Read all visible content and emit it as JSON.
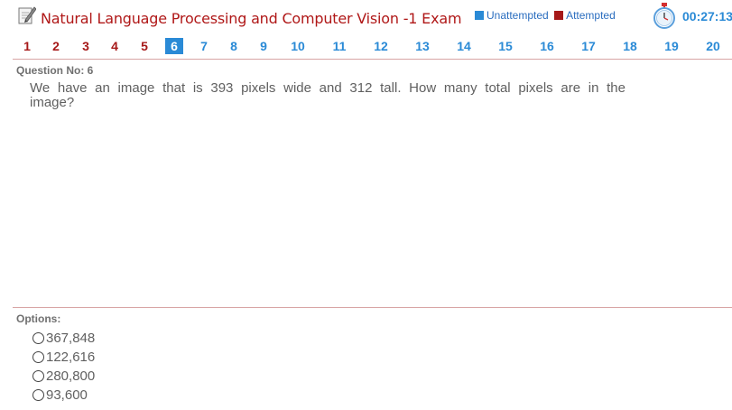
{
  "header": {
    "title": "Natural Language Processing and Computer Vision -1 Exam",
    "legend_unattempted": "Unattempted",
    "legend_attempted": "Attempted",
    "timer": "00:27:13"
  },
  "colors": {
    "attempted": "#a61919",
    "unattempted": "#2a8ad6",
    "current_bg": "#2a8ad6",
    "title": "#b01818"
  },
  "navigation": {
    "questions": [
      {
        "label": "1",
        "status": "attempted"
      },
      {
        "label": "2",
        "status": "attempted"
      },
      {
        "label": "3",
        "status": "attempted"
      },
      {
        "label": "4",
        "status": "attempted"
      },
      {
        "label": "5",
        "status": "attempted"
      },
      {
        "label": "6",
        "status": "current"
      },
      {
        "label": "7",
        "status": "unattempted"
      },
      {
        "label": "8",
        "status": "unattempted"
      },
      {
        "label": "9",
        "status": "unattempted"
      },
      {
        "label": "10",
        "status": "unattempted"
      },
      {
        "label": "11",
        "status": "unattempted"
      },
      {
        "label": "12",
        "status": "unattempted"
      },
      {
        "label": "13",
        "status": "unattempted"
      },
      {
        "label": "14",
        "status": "unattempted"
      },
      {
        "label": "15",
        "status": "unattempted"
      },
      {
        "label": "16",
        "status": "unattempted"
      },
      {
        "label": "17",
        "status": "unattempted"
      },
      {
        "label": "18",
        "status": "unattempted"
      },
      {
        "label": "19",
        "status": "unattempted"
      },
      {
        "label": "20",
        "status": "unattempted"
      }
    ]
  },
  "question": {
    "number_label": "Question No: 6",
    "text": "We have an image that is 393 pixels wide and 312 tall. How many total pixels are in the image?"
  },
  "options": {
    "label": "Options:",
    "items": [
      "367,848",
      "122,616",
      "280,800",
      "93,600"
    ]
  }
}
